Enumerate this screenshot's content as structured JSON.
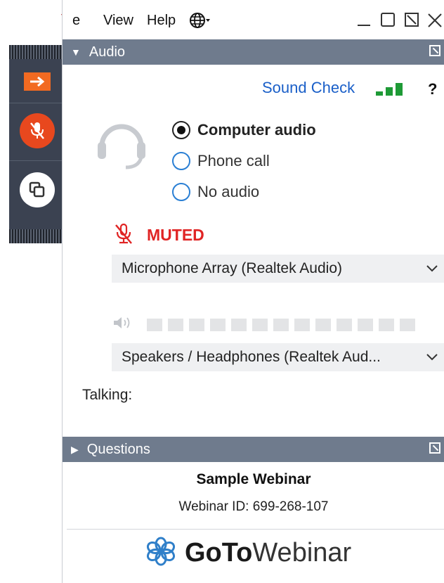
{
  "menubar": {
    "file_label": "File",
    "file_visible": "e",
    "view_label": "View",
    "help_label": "Help",
    "language_icon": "globe-icon",
    "window_controls": [
      "minimize-icon",
      "restore-icon",
      "detach-icon",
      "close-icon"
    ]
  },
  "control_strip": {
    "buttons": [
      {
        "icon": "arrow-right-icon",
        "color": "#f26a21"
      },
      {
        "icon": "microphone-muted-icon",
        "color": "#e8481e"
      },
      {
        "icon": "screen-share-icon",
        "color": "#ffffff"
      }
    ]
  },
  "audio_panel": {
    "title": "Audio",
    "sound_check_label": "Sound Check",
    "help_label": "?",
    "options": [
      {
        "label": "Computer audio",
        "selected": true
      },
      {
        "label": "Phone call",
        "selected": false
      },
      {
        "label": "No audio",
        "selected": false
      }
    ],
    "muted_label": "MUTED",
    "microphone_device": "Microphone Array (Realtek Audio)",
    "speaker_device": "Speakers / Headphones (Realtek Aud...",
    "talking_label": "Talking:"
  },
  "questions_panel": {
    "title": "Questions"
  },
  "footer": {
    "webinar_title": "Sample Webinar",
    "webinar_id": "Webinar ID: 699-268-107",
    "brand_goto": "GoTo",
    "brand_webinar": "Webinar"
  },
  "colors": {
    "accent_orange": "#f26a21",
    "muted_red": "#e02424",
    "panel_bar": "#6f7b8d",
    "link_blue": "#1a5fc8",
    "level_green": "#1e9a36",
    "brand_blue": "#2f7fc9"
  }
}
